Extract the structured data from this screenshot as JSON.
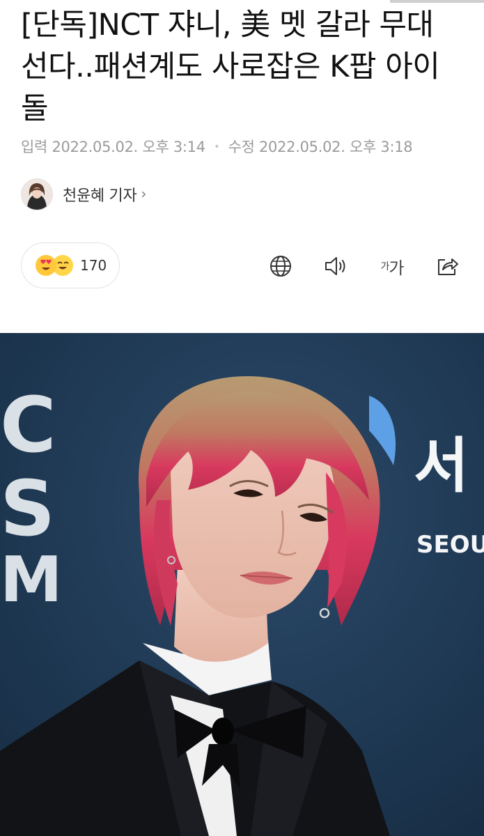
{
  "article": {
    "headline": "[단독]NCT 쟈니, 美 멧 갈라 무대 선다..패션계도 사로잡은 K팝 아이돌",
    "input_label": "입력",
    "input_time": "2022.05.02. 오후 3:14",
    "separator": "•",
    "modified_label": "수정",
    "modified_time": "2022.05.02. 오후 3:18"
  },
  "reporter": {
    "name": "천윤혜 기자",
    "chevron": "›"
  },
  "reactions": {
    "emoji_1": "love-eyes-emoji",
    "emoji_2": "smiling-emoji",
    "count": "170"
  },
  "toolbar": {
    "translate_icon": "globe-icon",
    "tts_icon": "speaker-icon",
    "font_size_small": "가",
    "font_size_large": "가",
    "share_icon": "share-icon"
  },
  "photo": {
    "backdrop_logo_text": "SEOUL",
    "backdrop_korean_text": "서"
  },
  "colors": {
    "headline": "#111111",
    "meta": "#9a9a9a",
    "photo_backdrop": "#1e3a56",
    "hair_pink": "#d8395e"
  }
}
